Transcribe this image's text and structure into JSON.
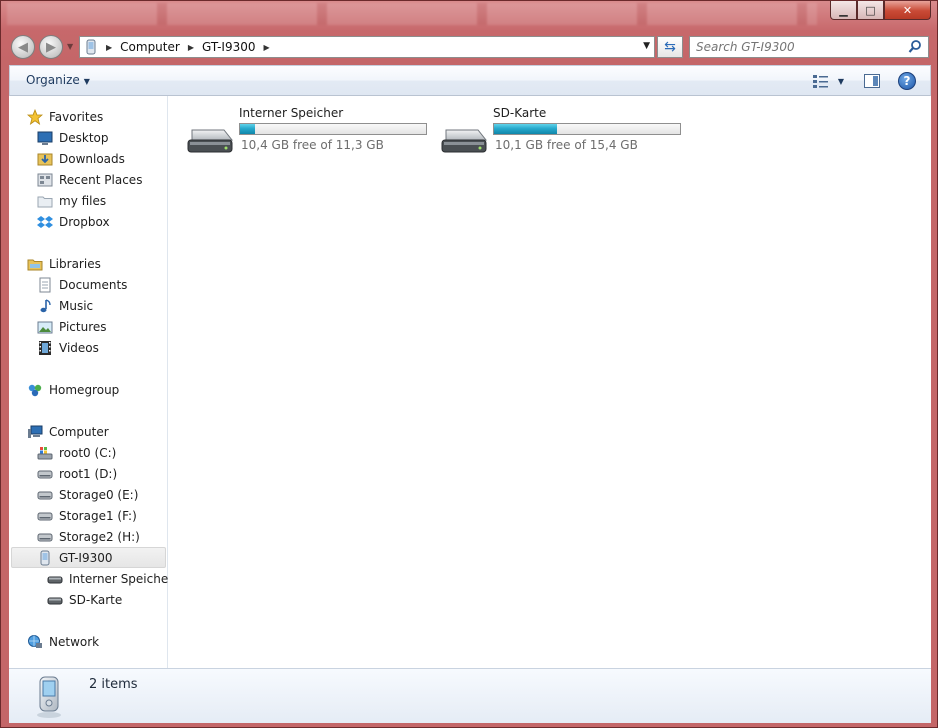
{
  "window": {
    "caption": {
      "minimize": "▁",
      "maximize": "□",
      "close": "✕"
    }
  },
  "address": {
    "crumbs": [
      "Computer",
      "GT-I9300"
    ]
  },
  "search": {
    "placeholder": "Search GT-I9300"
  },
  "toolbar": {
    "organize_label": "Organize"
  },
  "nav": {
    "favorites": {
      "label": "Favorites",
      "items": [
        "Desktop",
        "Downloads",
        "Recent Places",
        "my files",
        "Dropbox"
      ]
    },
    "libraries": {
      "label": "Libraries",
      "items": [
        "Documents",
        "Music",
        "Pictures",
        "Videos"
      ]
    },
    "homegroup": {
      "label": "Homegroup"
    },
    "computer": {
      "label": "Computer",
      "drives": [
        "root0 (C:)",
        "root1 (D:)",
        "Storage0 (E:)",
        "Storage1 (F:)",
        "Storage2 (H:)"
      ],
      "device": "GT-I9300",
      "device_children": [
        "Interner Speicher",
        "SD-Karte"
      ]
    },
    "network": {
      "label": "Network"
    }
  },
  "drives": [
    {
      "name": "Interner Speicher",
      "free_text": "10,4 GB free of 11,3 GB",
      "used_fraction": 0.08
    },
    {
      "name": "SD-Karte",
      "free_text": "10,1 GB free of 15,4 GB",
      "used_fraction": 0.34
    }
  ],
  "status": {
    "items_text": "2 items"
  },
  "colors": {
    "accent": "#1e3a5f",
    "bar_fill": "#27a9cc",
    "frame": "#c46668"
  }
}
